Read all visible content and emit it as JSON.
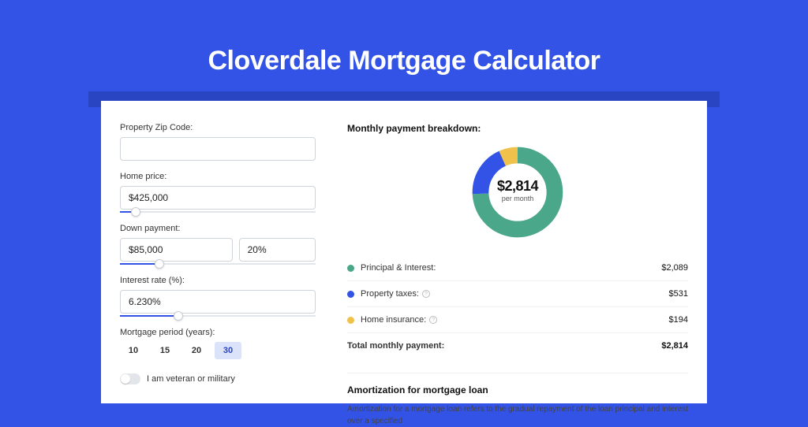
{
  "title": "Cloverdale Mortgage Calculator",
  "form": {
    "zip_label": "Property Zip Code:",
    "zip_value": "",
    "price_label": "Home price:",
    "price_value": "$425,000",
    "price_slider_pct": 8,
    "down_label": "Down payment:",
    "down_value": "$85,000",
    "down_pct_value": "20%",
    "down_slider_pct": 20,
    "rate_label": "Interest rate (%):",
    "rate_value": "6.230%",
    "rate_slider_pct": 30,
    "period_label": "Mortgage period (years):",
    "periods": [
      "10",
      "15",
      "20",
      "30"
    ],
    "period_active": "30",
    "veteran_label": "I am veteran or military"
  },
  "breakdown": {
    "title": "Monthly payment breakdown:",
    "center_value": "$2,814",
    "center_sub": "per month",
    "items": [
      {
        "label": "Principal & Interest:",
        "value": "$2,089",
        "color": "#4aa789",
        "info": false
      },
      {
        "label": "Property taxes:",
        "value": "$531",
        "color": "#3253e6",
        "info": true
      },
      {
        "label": "Home insurance:",
        "value": "$194",
        "color": "#f0c24b",
        "info": true
      }
    ],
    "total_label": "Total monthly payment:",
    "total_value": "$2,814"
  },
  "chart_data": {
    "type": "pie",
    "title": "Monthly payment breakdown",
    "series": [
      {
        "name": "Principal & Interest",
        "value": 2089,
        "color": "#4aa789"
      },
      {
        "name": "Property taxes",
        "value": 531,
        "color": "#3253e6"
      },
      {
        "name": "Home insurance",
        "value": 194,
        "color": "#f0c24b"
      }
    ],
    "total": 2814,
    "center_label": "$2,814 per month"
  },
  "amort": {
    "title": "Amortization for mortgage loan",
    "text": "Amortization for a mortgage loan refers to the gradual repayment of the loan principal and interest over a specified"
  }
}
